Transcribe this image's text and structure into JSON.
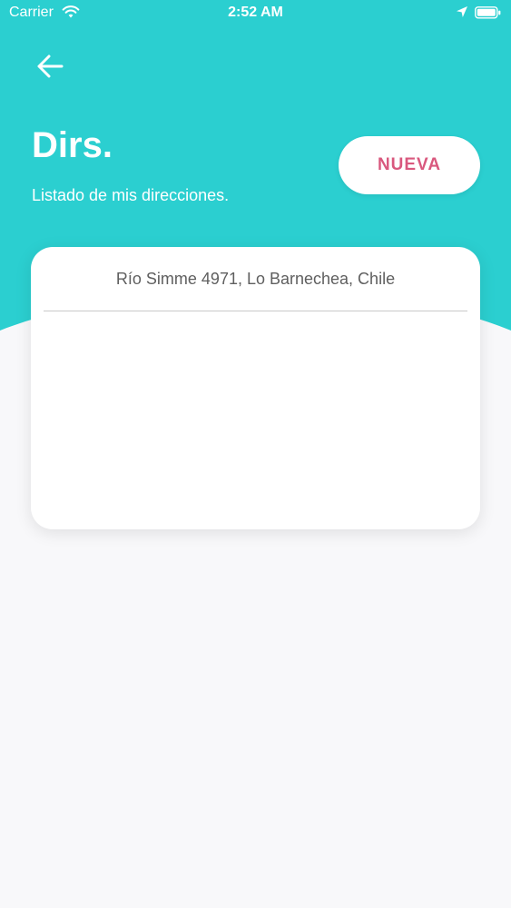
{
  "status_bar": {
    "carrier": "Carrier",
    "time": "2:52 AM",
    "icons": [
      "wifi-icon",
      "location-arrow-icon",
      "battery-icon"
    ]
  },
  "header": {
    "title": "Dirs.",
    "subtitle": "Listado de mis direcciones.",
    "back_icon": "arrow-left-icon",
    "new_button_label": "NUEVA"
  },
  "addresses": [
    "Río Simme 4971, Lo Barnechea, Chile"
  ],
  "colors": {
    "header_bg": "#2bcfd0",
    "page_bg": "#f8f8fa",
    "accent": "#d9587e",
    "address_text": "#5f5f5f"
  }
}
